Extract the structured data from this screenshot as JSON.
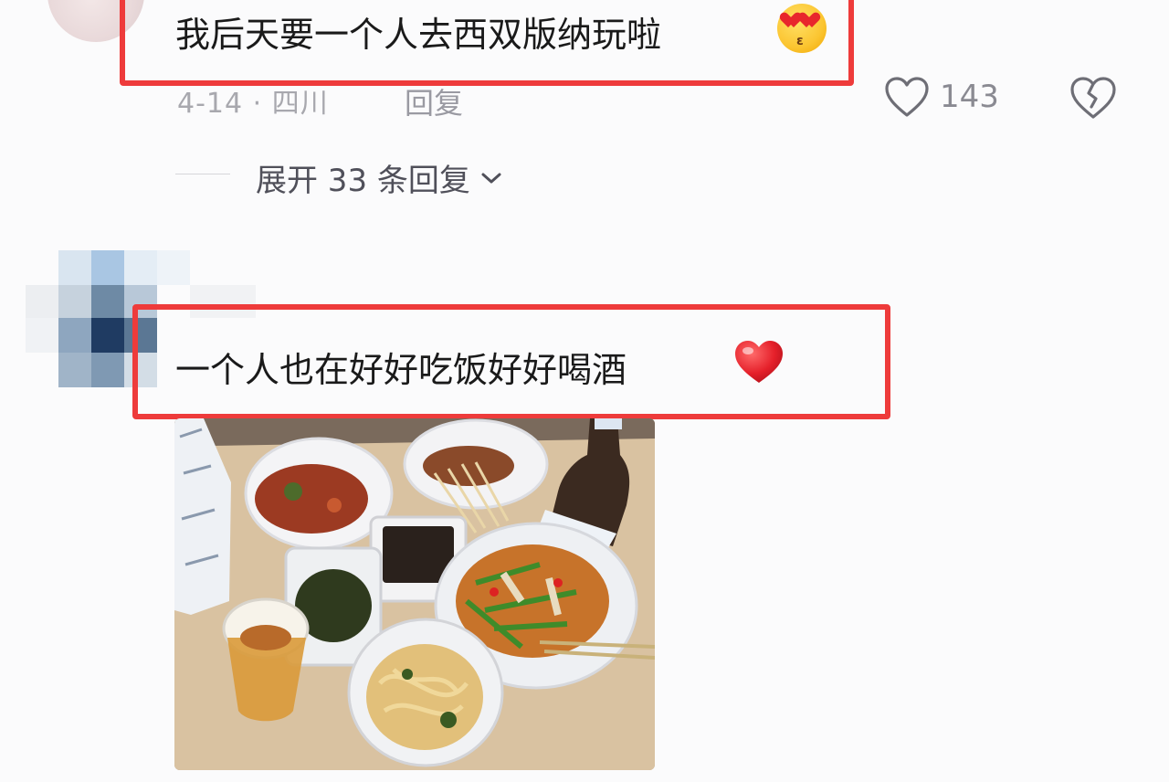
{
  "comment_1": {
    "text": "我后天要一个人去西双版纳玩啦",
    "emoji": "heart-eyes-kiss-emoji",
    "date_location": "4-14 · 四川",
    "reply_label": "回复",
    "like_count": "143",
    "expand_replies_label": "展开 33 条回复"
  },
  "comment_2": {
    "text": "一个人也在好好吃饭好好喝酒",
    "emoji": "red-heart-emoji",
    "image": "food-photo"
  },
  "colors": {
    "highlight": "#ee3b3b",
    "text": "#1a1a1a",
    "meta": "#a8a8ae"
  }
}
